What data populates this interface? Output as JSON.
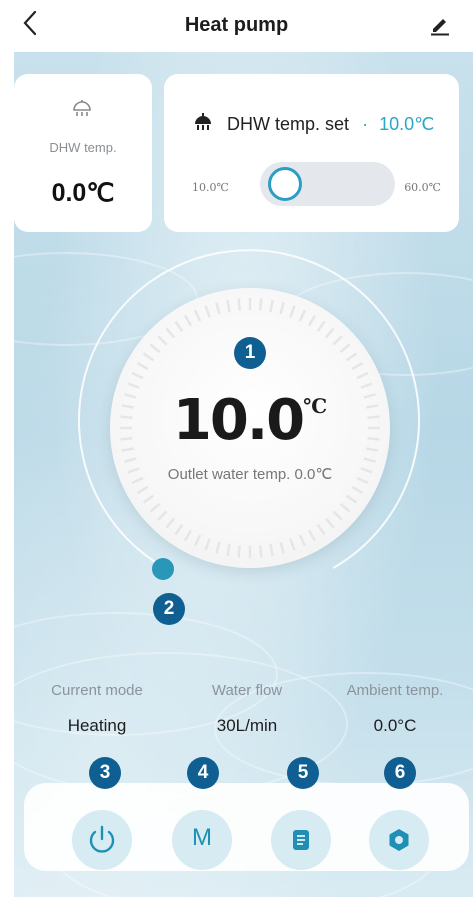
{
  "header": {
    "title": "Heat pump",
    "back_icon": "chevron-left-icon",
    "edit_icon": "pencil-icon"
  },
  "dhw_card": {
    "label": "DHW temp.",
    "value": "0.0℃",
    "icon": "shower-icon"
  },
  "dhw_set_card": {
    "label": "DHW temp. set",
    "separator": "·",
    "value": "10.0℃",
    "slider_min": "10.0℃",
    "slider_max": "60.0℃",
    "slider_fraction": 0.0,
    "icon": "shower-icon"
  },
  "dial": {
    "setpoint": "10.0",
    "unit": "℃",
    "outlet_label": "Outlet water temp. 0.0℃",
    "level_fraction": 0.0
  },
  "badges": [
    "1",
    "2",
    "3",
    "4",
    "5",
    "6"
  ],
  "stats": [
    {
      "label": "Current mode",
      "value": "Heating"
    },
    {
      "label": "Water flow",
      "value": "30L/min"
    },
    {
      "label": "Ambient temp.",
      "value": "0.0°C"
    }
  ],
  "bottom_buttons": [
    {
      "name": "power",
      "icon": "power-icon"
    },
    {
      "name": "mode",
      "text": "M",
      "icon": "mode-letter-icon"
    },
    {
      "name": "log",
      "icon": "document-icon"
    },
    {
      "name": "settings",
      "icon": "gear-icon"
    }
  ],
  "colors": {
    "accent": "#2aa8c3",
    "badge": "#0f5f93",
    "button_bg": "#d6ecf2"
  }
}
